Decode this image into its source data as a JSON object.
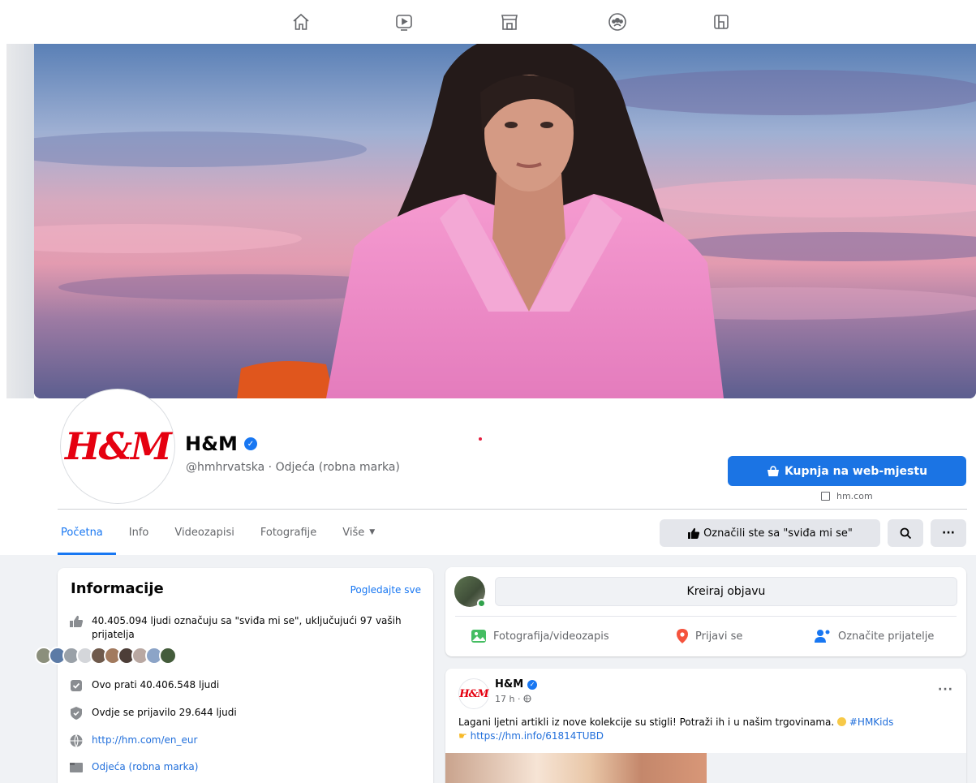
{
  "topnav": {
    "items": [
      {
        "name": "home-icon"
      },
      {
        "name": "video-icon"
      },
      {
        "name": "marketplace-icon"
      },
      {
        "name": "groups-icon"
      },
      {
        "name": "gaming-icon"
      }
    ]
  },
  "profile": {
    "logo_text": "H&M",
    "name": "H&M",
    "subtitle": "@hmhrvatska · Odjeća (robna marka)",
    "shop_button": "Kupnja na web-mjestu",
    "shop_link": "hm.com"
  },
  "tabs": [
    {
      "label": "Početna",
      "active": true
    },
    {
      "label": "Info"
    },
    {
      "label": "Videozapisi"
    },
    {
      "label": "Fotografije"
    },
    {
      "label": "Više"
    }
  ],
  "actions": {
    "liked_label": "Označili ste sa \"sviđa mi se\""
  },
  "info": {
    "title": "Informacije",
    "see_all": "Pogledajte sve",
    "likes_text": "40.405.094 ljudi označuju sa \"sviđa mi se\", uključujući 97 vaših prijatelja",
    "followers_text": "Ovo prati 40.406.548 ljudi",
    "checkins_text": "Ovdje se prijavilo 29.644 ljudi",
    "website": "http://hm.com/en_eur",
    "category": "Odjeća (robna marka)"
  },
  "composer": {
    "placeholder": "Kreiraj objavu",
    "photo_label": "Fotografija/videozapis",
    "checkin_label": "Prijavi se",
    "tag_label": "Označite prijatelje"
  },
  "post": {
    "author": "H&M",
    "logo_text": "H&M",
    "time": "17 h ·",
    "text_main": "Lagani ljetni artikli iz nove kolekcije su stigli! Potraži ih i u našim trgovinama.",
    "hashtag": "#HMKids",
    "link": "https://hm.info/61814TUBD"
  },
  "colors": {
    "accent": "#1877f2",
    "brand_red": "#e50010",
    "background": "#f0f2f5"
  }
}
